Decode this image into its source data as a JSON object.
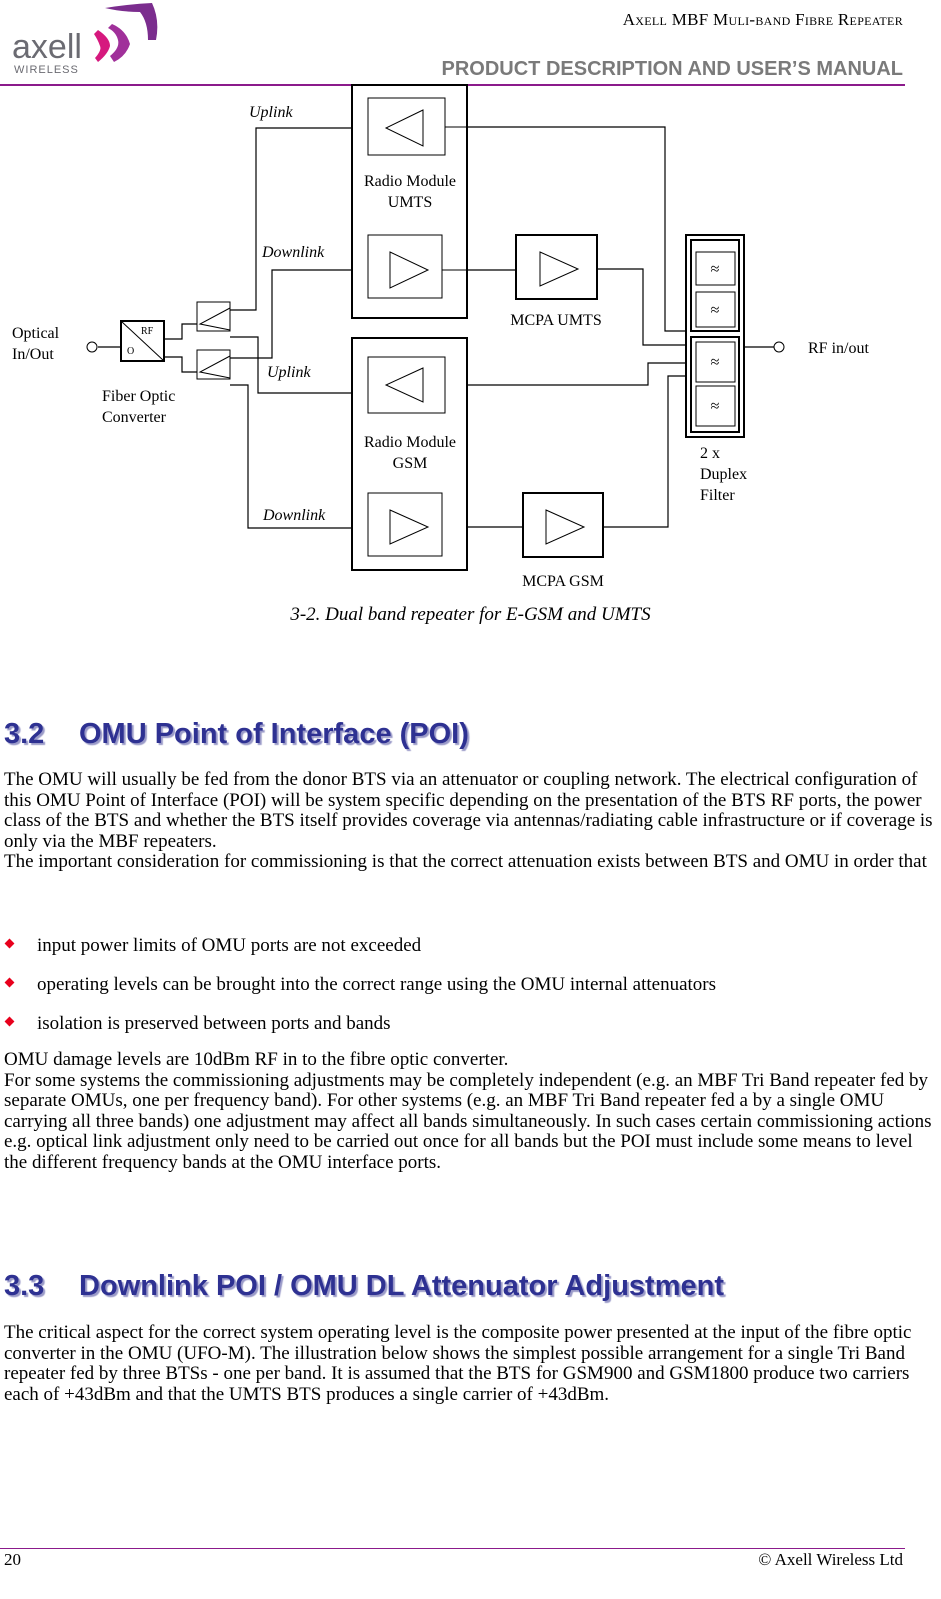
{
  "header": {
    "logo_text": "axell",
    "logo_sub": "WIRELESS",
    "title": "Axell MBF Muli-band Fibre Repeater",
    "subtitle": "PRODUCT DESCRIPTION AND USER’S MANUAL"
  },
  "diagram": {
    "optical": [
      "Optical",
      "In/Out"
    ],
    "converter_rf": "RF",
    "converter_o": "O",
    "converter": [
      "Fiber Optic",
      "Converter"
    ],
    "uplink": "Uplink",
    "downlink": "Downlink",
    "rm_umts": [
      "Radio Module",
      "UMTS"
    ],
    "rm_gsm": [
      "Radio Module",
      "GSM"
    ],
    "mcpa_umts": "MCPA UMTS",
    "mcpa_gsm": "MCPA GSM",
    "duplex": [
      "2 x",
      "Duplex",
      "Filter"
    ],
    "rf_inout": "RF in/out",
    "filter_glyph": "≈"
  },
  "caption": "3-2. Dual band repeater for E-GSM and UMTS",
  "section_3_2": {
    "number": "3.2",
    "title": "OMU Point of Interface (POI)",
    "para1": "The OMU will usually be fed from the donor BTS via an attenuator or coupling network. The electrical configuration of this OMU Point of Interface (POI) will be system specific depending on the presentation of the BTS RF ports, the power class of the BTS and whether the BTS itself provides coverage via antennas/radiating cable infrastructure or if coverage is only via the MBF repeaters.",
    "para2": "The important consideration for commissioning is that the correct attenuation exists between BTS and OMU in order that",
    "bullets": [
      "input power limits of OMU ports are not exceeded",
      "operating levels can be brought into the correct range using the OMU internal attenuators",
      "isolation is preserved between ports and bands"
    ],
    "para3": "OMU damage levels are 10dBm RF in to the fibre optic converter.",
    "para4": "For some systems the commissioning adjustments may be completely independent (e.g. an MBF Tri Band repeater fed by separate OMUs, one per frequency band). For other systems (e.g. an MBF Tri Band repeater fed a by a single OMU carrying all three bands) one adjustment may affect all bands simultaneously. In such cases certain commissioning actions e.g. optical link adjustment only need to be carried out once for all bands but the POI must include some means to level the different frequency bands at the OMU interface ports."
  },
  "section_3_3": {
    "number": "3.3",
    "title": "Downlink POI / OMU DL Attenuator Adjustment",
    "para1": "The critical aspect for the correct system operating level is the composite power presented at the input of the fibre optic converter in the OMU (UFO-M). The illustration below shows the simplest possible arrangement for a single Tri Band repeater fed by three BTSs - one per band. It is assumed that the BTS for GSM900 and GSM1800 produce two carriers each of +43dBm and that the UMTS BTS produces a single carrier of +43dBm."
  },
  "footer": {
    "page": "20",
    "copyright": "© Axell Wireless Ltd"
  },
  "colors": {
    "heading": "#2e3192",
    "rule": "#8b1a8b",
    "bullet": "#e8001c",
    "logo_purple": "#7b2d8e",
    "logo_magenta": "#d6197e"
  }
}
